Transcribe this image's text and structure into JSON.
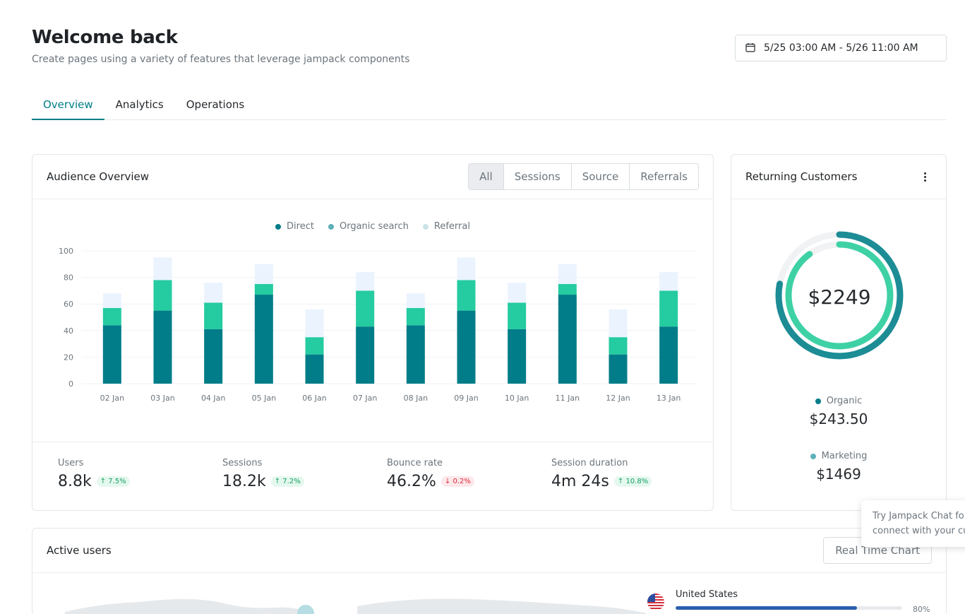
{
  "header": {
    "title": "Welcome back",
    "subtitle": "Create pages using a variety of features that leverage jampack components"
  },
  "date_range": {
    "label": "5/25 03:00 AM - 5/26 11:00 AM"
  },
  "tabs": [
    {
      "label": "Overview",
      "active": true
    },
    {
      "label": "Analytics",
      "active": false
    },
    {
      "label": "Operations",
      "active": false
    }
  ],
  "audience": {
    "title": "Audience Overview",
    "filters": [
      {
        "label": "All",
        "active": true
      },
      {
        "label": "Sessions",
        "active": false
      },
      {
        "label": "Source",
        "active": false
      },
      {
        "label": "Referrals",
        "active": false
      }
    ],
    "legend": [
      {
        "label": "Direct",
        "color": "#007d88"
      },
      {
        "label": "Organic search",
        "color": "#5fb0b8"
      },
      {
        "label": "Referral",
        "color": "#c9e3e8"
      }
    ],
    "stats": [
      {
        "label": "Users",
        "value": "8.8k",
        "change": "↑ 7.5%",
        "direction": "up"
      },
      {
        "label": "Sessions",
        "value": "18.2k",
        "change": "↑ 7.2%",
        "direction": "up"
      },
      {
        "label": "Bounce rate",
        "value": "46.2%",
        "change": "↓ 0.2%",
        "direction": "down"
      },
      {
        "label": "Session duration",
        "value": "4m 24s",
        "change": "↑ 10.8%",
        "direction": "up"
      }
    ]
  },
  "chart_data": {
    "type": "bar",
    "stacked": true,
    "categories": [
      "02 Jan",
      "03 Jan",
      "04 Jan",
      "05 Jan",
      "06 Jan",
      "07 Jan",
      "08 Jan",
      "09 Jan",
      "10 Jan",
      "11 Jan",
      "12 Jan",
      "13 Jan"
    ],
    "series": [
      {
        "name": "Direct",
        "color": "#007d88",
        "values": [
          44,
          55,
          41,
          67,
          22,
          43,
          44,
          55,
          41,
          67,
          22,
          43
        ]
      },
      {
        "name": "Organic search",
        "color": "#25cba1",
        "values": [
          13,
          23,
          20,
          8,
          13,
          27,
          13,
          23,
          20,
          8,
          13,
          27
        ]
      },
      {
        "name": "Referral",
        "color": "#ebf3fe",
        "values": [
          11,
          17,
          15,
          15,
          21,
          14,
          11,
          17,
          15,
          15,
          21,
          14
        ]
      }
    ],
    "yticks": [
      0,
      20,
      40,
      60,
      80,
      100
    ],
    "ylim": [
      0,
      100
    ],
    "grid": true,
    "legend_position": "top-center"
  },
  "returning": {
    "title": "Returning Customers",
    "total": "$2249",
    "outer_ring": 0.78,
    "inner_ring": 0.9,
    "items": [
      {
        "label": "Organic",
        "value": "$243.50",
        "color": "#007d88"
      },
      {
        "label": "Marketing",
        "value": "$1469",
        "color": "#5fb0b8"
      }
    ]
  },
  "active_users": {
    "title": "Active users",
    "button": "Real Time Chart",
    "countries": [
      {
        "name": "United States",
        "percent": "80%",
        "fraction": 0.8
      }
    ]
  },
  "tooltip": {
    "line1": "Try Jampack Chat fo",
    "line2": "connect with your cu"
  }
}
